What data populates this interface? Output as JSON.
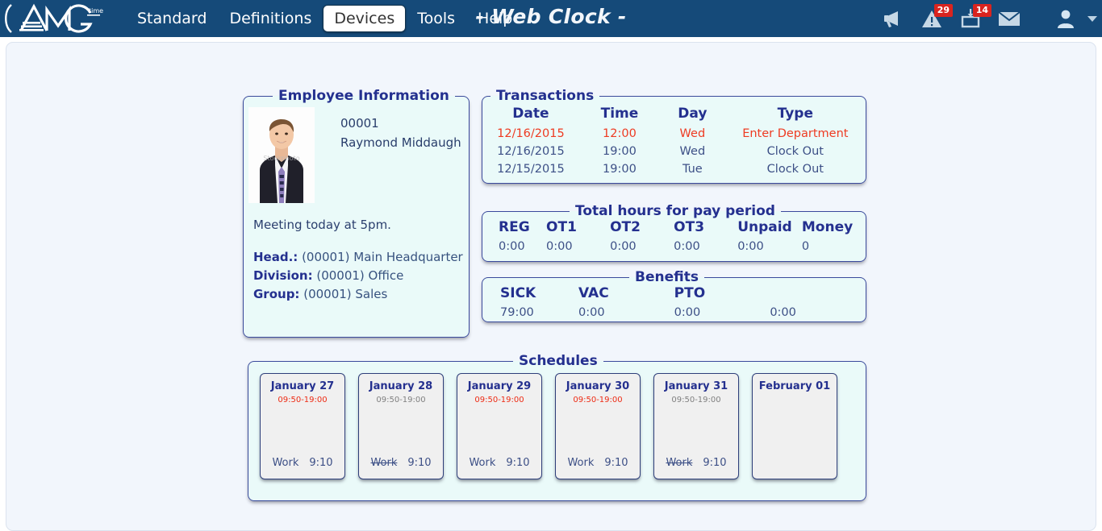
{
  "brand": {
    "name": "AMG",
    "superscript": "time"
  },
  "nav": {
    "items": [
      {
        "label": "Standard",
        "active": false
      },
      {
        "label": "Definitions",
        "active": false
      },
      {
        "label": "Devices",
        "active": true
      },
      {
        "label": "Tools",
        "active": false
      },
      {
        "label": "Help",
        "active": false
      }
    ]
  },
  "header": {
    "title": "- Web Clock -",
    "icons": [
      {
        "name": "megaphone-icon",
        "badge": null
      },
      {
        "name": "warning-triangle-icon",
        "badge": "29"
      },
      {
        "name": "device-inbox-icon",
        "badge": "14"
      },
      {
        "name": "envelope-icon",
        "badge": null
      },
      {
        "name": "user-avatar-icon",
        "badge": null
      }
    ]
  },
  "employee": {
    "legend": "Employee Information",
    "id": "00001",
    "name": "Raymond Middaugh",
    "note": "Meeting today at 5pm.",
    "meta": [
      {
        "label": "Head.:",
        "value": "(00001) Main Headquarter"
      },
      {
        "label": "Division:",
        "value": "(00001) Office"
      },
      {
        "label": "Group:",
        "value": "(00001) Sales"
      }
    ]
  },
  "transactions": {
    "legend": "Transactions",
    "columns": [
      "Date",
      "Time",
      "Day",
      "Type"
    ],
    "rows": [
      {
        "date": "12/16/2015",
        "time": "12:00",
        "day": "Wed",
        "type": "Enter Department",
        "highlight": true
      },
      {
        "date": "12/16/2015",
        "time": "19:00",
        "day": "Wed",
        "type": "Clock Out",
        "highlight": false
      },
      {
        "date": "12/15/2015",
        "time": "19:00",
        "day": "Tue",
        "type": "Clock Out",
        "highlight": false
      }
    ]
  },
  "total_hours": {
    "legend": "Total hours for pay period",
    "columns": [
      "REG",
      "OT1",
      "OT2",
      "OT3",
      "Unpaid",
      "Money"
    ],
    "values": [
      "0:00",
      "0:00",
      "0:00",
      "0:00",
      "0:00",
      "0"
    ]
  },
  "benefits": {
    "legend": "Benefits",
    "columns": [
      "SICK",
      "VAC",
      "PTO",
      ""
    ],
    "values": [
      "79:00",
      "0:00",
      "0:00",
      "0:00"
    ]
  },
  "schedules": {
    "legend": "Schedules",
    "cards": [
      {
        "date": "January 27",
        "time": "09:50-19:00",
        "time_color": "red",
        "label": "Work",
        "hours": "9:10",
        "struck": false
      },
      {
        "date": "January 28",
        "time": "09:50-19:00",
        "time_color": "gray",
        "label": "Work",
        "hours": "9:10",
        "struck": true
      },
      {
        "date": "January 29",
        "time": "09:50-19:00",
        "time_color": "red",
        "label": "Work",
        "hours": "9:10",
        "struck": false
      },
      {
        "date": "January 30",
        "time": "09:50-19:00",
        "time_color": "red",
        "label": "Work",
        "hours": "9:10",
        "struck": false
      },
      {
        "date": "January 31",
        "time": "09:50-19:00",
        "time_color": "gray",
        "label": "Work",
        "hours": "9:10",
        "struck": true
      },
      {
        "date": "February 01",
        "time": "",
        "time_color": "gray",
        "label": "",
        "hours": "",
        "struck": false
      }
    ]
  },
  "colors": {
    "nav_bg": "#154a79",
    "panel_border": "#3b4a9c",
    "panel_bg": "#eafaf9",
    "legend_text": "#24308f",
    "highlight_red": "#ee3b22",
    "badge_red": "#d9241f"
  }
}
